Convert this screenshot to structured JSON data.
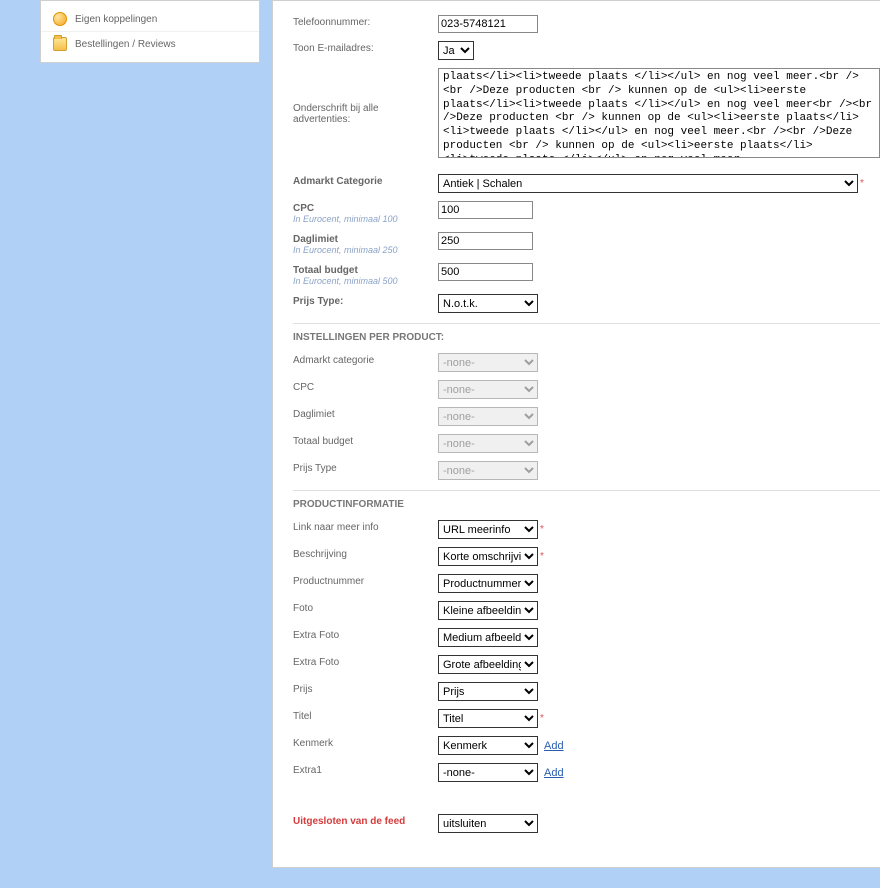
{
  "sidebar": {
    "items": [
      {
        "label": "Eigen koppelingen"
      },
      {
        "label": "Bestellingen / Reviews"
      }
    ]
  },
  "form": {
    "telefoon": {
      "label": "Telefoonnummer:",
      "value": "023-5748121"
    },
    "toon_email": {
      "label": "Toon E-mailadres:",
      "value": "Ja"
    },
    "onderschrift": {
      "label": "Onderschrift bij alle advertenties:",
      "value": "plaats</li><li>tweede plaats </li></ul> en nog veel meer.<br /><br />Deze producten <br /> kunnen op de <ul><li>eerste plaats</li><li>tweede plaats </li></ul> en nog veel meer<br /><br />Deze producten <br /> kunnen op de <ul><li>eerste plaats</li><li>tweede plaats </li></ul> en nog veel meer.<br /><br />Deze producten <br /> kunnen op de <ul><li>eerste plaats</li><li>tweede plaats </li></ul> en nog veel meer"
    },
    "categorie": {
      "label": "Admarkt Categorie",
      "value": "Antiek | Schalen"
    },
    "cpc": {
      "label": "CPC",
      "hint": "In Eurocent, minimaal 100",
      "value": "100"
    },
    "daglimiet": {
      "label": "Daglimiet",
      "hint": "In Eurocent, minimaal 250",
      "value": "250"
    },
    "totaal": {
      "label": "Totaal budget",
      "hint": "In Eurocent, minimaal 500",
      "value": "500"
    },
    "prijstype": {
      "label": "Prijs Type:",
      "value": "N.o.t.k."
    }
  },
  "ipp": {
    "title": "INSTELLINGEN PER PRODUCT:",
    "rows": {
      "categorie": {
        "label": "Admarkt categorie",
        "value": "-none-"
      },
      "cpc": {
        "label": "CPC",
        "value": "-none-"
      },
      "daglimiet": {
        "label": "Daglimiet",
        "value": "-none-"
      },
      "totaal": {
        "label": "Totaal budget",
        "value": "-none-"
      },
      "prijstype": {
        "label": "Prijs Type",
        "value": "-none-"
      }
    }
  },
  "pi": {
    "title": "PRODUCTINFORMATIE",
    "rows": {
      "link": {
        "label": "Link naar meer info",
        "value": "URL meerinfo"
      },
      "beschrijving": {
        "label": "Beschrijving",
        "value": "Korte omschrijving"
      },
      "productnummer": {
        "label": "Productnummer",
        "value": "Productnummer"
      },
      "foto": {
        "label": "Foto",
        "value": "Kleine afbeelding"
      },
      "extrafoto1": {
        "label": "Extra Foto",
        "value": "Medium afbeelding"
      },
      "extrafoto2": {
        "label": "Extra Foto",
        "value": "Grote afbeelding"
      },
      "prijs": {
        "label": "Prijs",
        "value": "Prijs"
      },
      "titel": {
        "label": "Titel",
        "value": "Titel"
      },
      "kenmerk": {
        "label": "Kenmerk",
        "value": "Kenmerk"
      },
      "extra1": {
        "label": "Extra1",
        "value": "-none-"
      }
    },
    "add": "Add"
  },
  "excluded": {
    "label": "Uitgesloten van de feed",
    "value": "uitsluiten"
  }
}
